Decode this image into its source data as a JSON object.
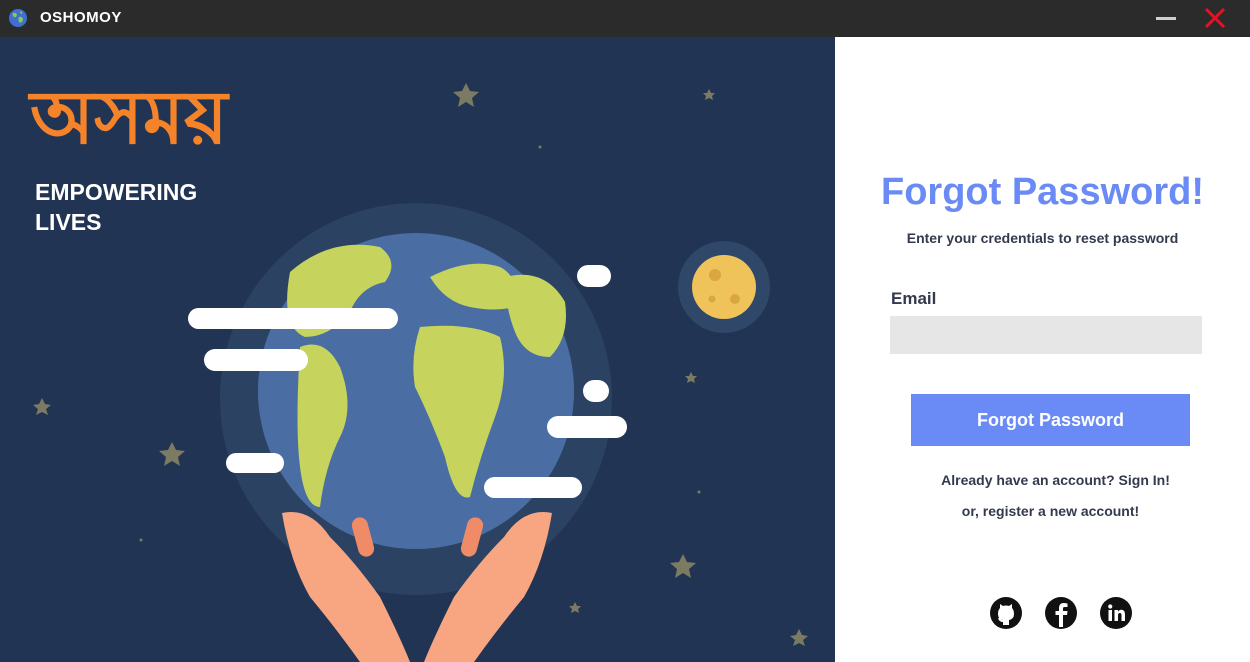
{
  "window": {
    "title": "OSHOMOY",
    "app_icon": "globe-icon",
    "controls": [
      "minimize-icon",
      "close-icon"
    ],
    "close_color": "#e81123"
  },
  "hero": {
    "brand_bangla": "অসময়",
    "tagline": "EMPOWERING LIVES",
    "background_color": "#223454",
    "accent_color": "#f5832a"
  },
  "form": {
    "title": "Forgot Password!",
    "subtitle": "Enter your credentials to reset password",
    "email_label": "Email",
    "email_value": "",
    "submit_label": "Forgot Password",
    "signin_text": "Already have an account? Sign In!",
    "register_text": "or, register a new account!",
    "accent_color": "#6a8bf5"
  },
  "social": [
    {
      "name": "github",
      "icon": "github-icon"
    },
    {
      "name": "facebook",
      "icon": "facebook-icon"
    },
    {
      "name": "linkedin",
      "icon": "linkedin-icon"
    }
  ]
}
